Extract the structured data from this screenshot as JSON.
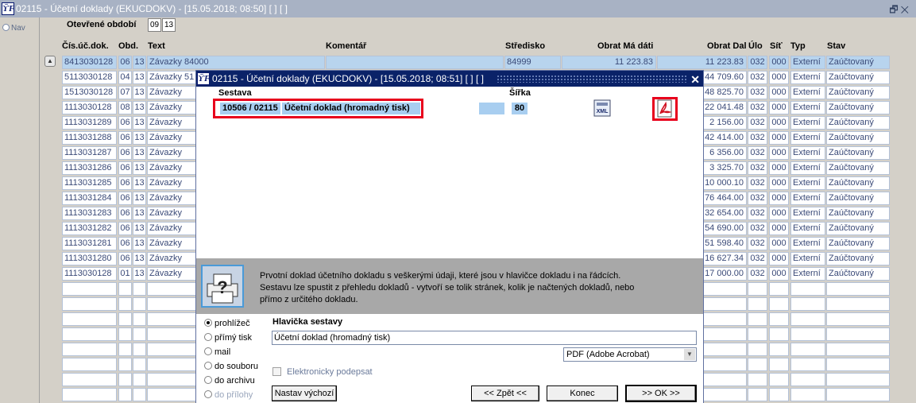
{
  "window": {
    "title": "02115 - Účetní doklady (EKUCDOKV) - [15.05.2018; 08:50]  [ ]  [ ]",
    "controls": "🗗✕"
  },
  "nav": {
    "label": "Nav"
  },
  "period": {
    "label": "Otevřené období",
    "values": [
      "09",
      "13"
    ]
  },
  "columns": {
    "doc": "Čís.úč.dok.",
    "obd": "Obd.",
    "text": "Text",
    "koment": "Komentář",
    "stredisko": "Středisko",
    "obrat_md": "Obrat Má dáti",
    "obrat_dal": "Obrat Dal",
    "ulo": "Úlo",
    "sit": "Síť",
    "typ": "Typ",
    "stav": "Stav"
  },
  "rows": [
    {
      "doc": "8413030128",
      "obd": "06",
      "n": "13",
      "text": "Závazky 84000",
      "koment": "",
      "stredisko": "84999",
      "md": "11 223.83",
      "dal": "11 223.83",
      "ulo": "032",
      "sit": "000",
      "typ": "Externí",
      "stav": "Zaúčtovaný"
    },
    {
      "doc": "5113030128",
      "obd": "04",
      "n": "13",
      "text": "Závazky 51",
      "dal": "44 709.60",
      "ulo": "032",
      "sit": "000",
      "typ": "Externí",
      "stav": "Zaúčtovaný"
    },
    {
      "doc": "1513030128",
      "obd": "07",
      "n": "13",
      "text": "Závazky",
      "dal": "48 825.70",
      "ulo": "032",
      "sit": "000",
      "typ": "Externí",
      "stav": "Zaúčtovaný"
    },
    {
      "doc": "1113030128",
      "obd": "08",
      "n": "13",
      "text": "Závazky",
      "dal": "22 041.48",
      "ulo": "032",
      "sit": "000",
      "typ": "Externí",
      "stav": "Zaúčtovaný"
    },
    {
      "doc": "1113031289",
      "obd": "06",
      "n": "13",
      "text": "Závazky",
      "dal": "2 156.00",
      "ulo": "032",
      "sit": "000",
      "typ": "Externí",
      "stav": "Zaúčtovaný"
    },
    {
      "doc": "1113031288",
      "obd": "06",
      "n": "13",
      "text": "Závazky",
      "dal": "42 414.00",
      "ulo": "032",
      "sit": "000",
      "typ": "Externí",
      "stav": "Zaúčtovaný"
    },
    {
      "doc": "1113031287",
      "obd": "06",
      "n": "13",
      "text": "Závazky",
      "dal": "6 356.00",
      "ulo": "032",
      "sit": "000",
      "typ": "Externí",
      "stav": "Zaúčtovaný"
    },
    {
      "doc": "1113031286",
      "obd": "06",
      "n": "13",
      "text": "Závazky",
      "dal": "3 325.70",
      "ulo": "032",
      "sit": "000",
      "typ": "Externí",
      "stav": "Zaúčtovaný"
    },
    {
      "doc": "1113031285",
      "obd": "06",
      "n": "13",
      "text": "Závazky",
      "dal": "10 000.10",
      "ulo": "032",
      "sit": "000",
      "typ": "Externí",
      "stav": "Zaúčtovaný"
    },
    {
      "doc": "1113031284",
      "obd": "06",
      "n": "13",
      "text": "Závazky",
      "dal": "76 464.00",
      "ulo": "032",
      "sit": "000",
      "typ": "Externí",
      "stav": "Zaúčtovaný"
    },
    {
      "doc": "1113031283",
      "obd": "06",
      "n": "13",
      "text": "Závazky",
      "dal": "32 654.00",
      "ulo": "032",
      "sit": "000",
      "typ": "Externí",
      "stav": "Zaúčtovaný"
    },
    {
      "doc": "1113031282",
      "obd": "06",
      "n": "13",
      "text": "Závazky",
      "dal": "54 690.00",
      "ulo": "032",
      "sit": "000",
      "typ": "Externí",
      "stav": "Zaúčtovaný"
    },
    {
      "doc": "1113031281",
      "obd": "06",
      "n": "13",
      "text": "Závazky",
      "dal": "51 598.40",
      "ulo": "032",
      "sit": "000",
      "typ": "Externí",
      "stav": "Zaúčtovaný"
    },
    {
      "doc": "1113031280",
      "obd": "06",
      "n": "13",
      "text": "Závazky",
      "dal": "16 627.34",
      "ulo": "032",
      "sit": "000",
      "typ": "Externí",
      "stav": "Zaúčtovaný"
    },
    {
      "doc": "1113030128",
      "obd": "01",
      "n": "13",
      "text": "Závazky",
      "dal": "17 000.00",
      "ulo": "032",
      "sit": "000",
      "typ": "Externí",
      "stav": "Zaúčtovaný"
    }
  ],
  "dialog": {
    "title": "02115 - Účetní doklady (EKUCDOKV) - [15.05.2018; 08:51]  [ ]  [ ]",
    "close": "✕",
    "col_sestava": "Sestava",
    "col_sirka": "Šířka",
    "report_code": "10506 / 02115",
    "report_name": "Účetní doklad (hromadný tisk)",
    "report_width": "80",
    "xml_icon_text": "XML",
    "description": "Prvotní doklad účetního dokladu s veškerými údaji, které jsou v hlavičce dokladu i na řádcích. Sestavu lze spustit z přehledu dokladů - vytvoří se tolik stránek, kolik je načtených dokladů, nebo přímo z určitého dokladu.",
    "outputs": [
      "prohlížeč",
      "přímý tisk",
      "mail",
      "do souboru",
      "do archivu",
      "do přílohy"
    ],
    "header_label": "Hlavička sestavy",
    "header_value": "Účetní doklad (hromadný tisk)",
    "format_value": "PDF (Adobe Acrobat)",
    "esign_label": "Elektronicky podepsat",
    "btn_default": "Nastav výchozí",
    "btn_back": "<< Zpět <<",
    "btn_cancel": "Konec",
    "btn_ok": ">> OK >>"
  }
}
